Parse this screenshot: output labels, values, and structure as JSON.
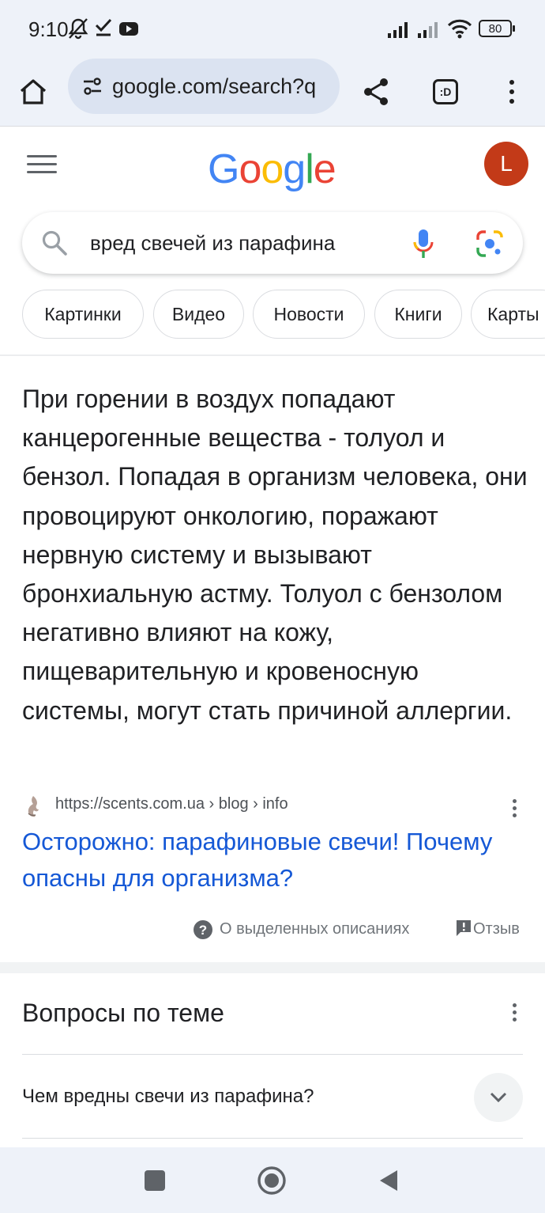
{
  "status_bar": {
    "time": "9:10",
    "battery": "80",
    "icons": [
      "notifications-off-icon",
      "check-icon",
      "youtube-icon",
      "signal-icon",
      "signal-icon",
      "wifi-icon",
      "battery-icon"
    ]
  },
  "browser": {
    "url": "google.com/search?q",
    "icons": [
      "home-icon",
      "site-info-icon",
      "share-icon",
      "tab-switcher-icon",
      "more-vert-icon"
    ],
    "tab_switcher_label": ":D"
  },
  "google": {
    "logo": [
      "G",
      "o",
      "o",
      "g",
      "l",
      "e"
    ],
    "logo_colors": [
      "#4285F4",
      "#EA4335",
      "#FBBC05",
      "#4285F4",
      "#34A853",
      "#EA4335"
    ],
    "avatar_letter": "L",
    "avatar_color": "#C33A18",
    "search_query": "вред свечей из парафина",
    "chips": [
      "Картинки",
      "Видео",
      "Новости",
      "Книги",
      "Карты"
    ]
  },
  "snippet": {
    "text": "При горении в воздух попадают канцерогенные вещества - толуол и бензол. Попадая в организм человека, они провоцируют онкологию, поражают нервную систему и вызывают бронхиальную астму. Толуол с бензолом негативно влияют на кожу, пищеварительную и кровеносную системы, могут стать причиной аллергии.",
    "source_url": "https://scents.com.ua › blog › info",
    "result_title": "Осторожно: парафиновые свечи! Почему опасны для организма?",
    "about_label": "О выделенных описаниях",
    "feedback_label": "Отзыв",
    "link_color": "#1558D6"
  },
  "related": {
    "title": "Вопросы по теме",
    "questions": [
      "Чем вредны свечи из парафина?"
    ]
  },
  "nav": {
    "icons": [
      "recents-icon",
      "home-nav-icon",
      "back-icon"
    ]
  }
}
